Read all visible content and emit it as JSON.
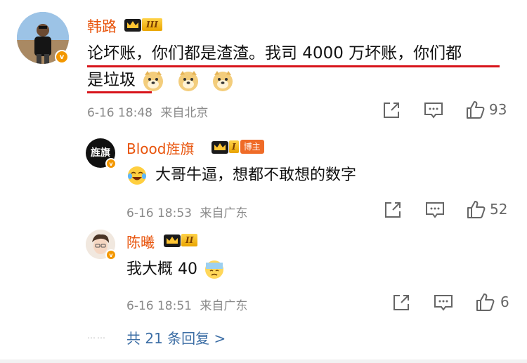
{
  "colors": {
    "username": "#e8540c",
    "link": "#3c6ea5",
    "meta": "#8a8a8a",
    "underline": "#d8141b",
    "vip_badge": "#f39700"
  },
  "main_comment": {
    "author": "韩路",
    "level": "III",
    "text_line1": "论坏账，你们都是渣渣。我司 4000 万坏账，你们都",
    "text_line2": "是垃圾",
    "emoji": "doge-emoji",
    "emoji_count": 3,
    "time": "6-16 18:48",
    "source": "来自北京",
    "likes": "93"
  },
  "replies": [
    {
      "author": "Blood旌旗",
      "avatar_text": "旌旗",
      "level": "I",
      "badge": "博主",
      "emoji": "laugh-cry-emoji",
      "text": "大哥牛逼，想都不敢想的数字",
      "time": "6-16 18:53",
      "source": "来自广东",
      "likes": "52"
    },
    {
      "author": "陈曦",
      "level": "II",
      "text": "我大概 40",
      "emoji": "sweat-emoji",
      "time": "6-16 18:51",
      "source": "来自广东",
      "likes": "6"
    }
  ],
  "more_replies": "共 21 条回复 >",
  "dots": "⋯⋯",
  "icons": {
    "share": "share-icon",
    "comment": "comment-icon",
    "like": "like-icon"
  }
}
